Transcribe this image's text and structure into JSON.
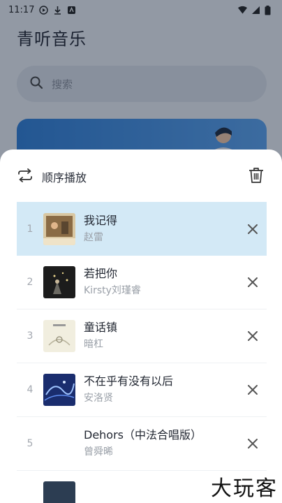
{
  "status_bar": {
    "time": "11:17"
  },
  "app": {
    "title": "青听音乐",
    "search_placeholder": "搜索"
  },
  "playlist_sheet": {
    "mode_label": "顺序播放",
    "songs": [
      {
        "index": "1",
        "title": "我记得",
        "artist": "赵雷",
        "active": true
      },
      {
        "index": "2",
        "title": "若把你",
        "artist": "Kirsty刘瑾睿",
        "active": false
      },
      {
        "index": "3",
        "title": "童话镇",
        "artist": "暗杠",
        "active": false
      },
      {
        "index": "4",
        "title": "不在乎有没有以后",
        "artist": "安洛贤",
        "active": false
      },
      {
        "index": "5",
        "title": "Dehors（中法合唱版）",
        "artist": "曾舜晞",
        "active": false
      }
    ]
  },
  "watermark": "大玩客",
  "colors": {
    "active_row": "#d3e9f6",
    "sheet_bg": "#ffffff",
    "banner": "#2f7fd8"
  }
}
